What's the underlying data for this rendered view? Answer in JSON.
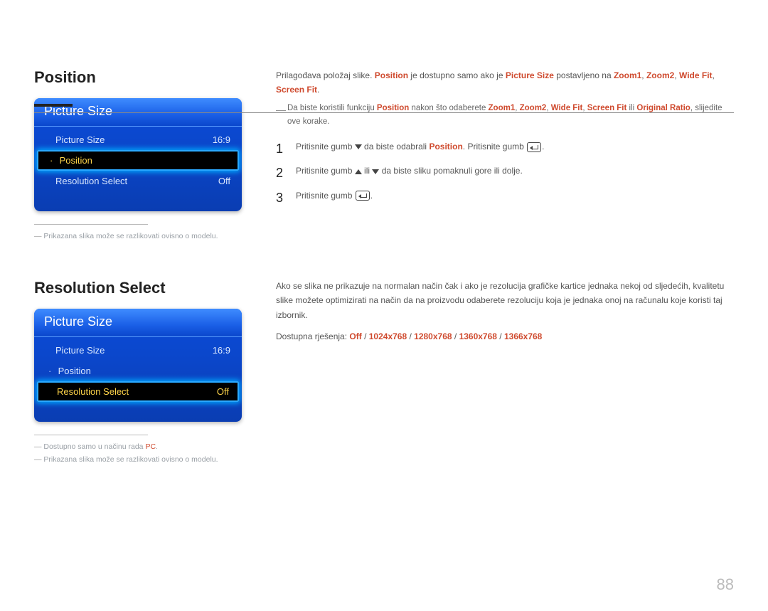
{
  "page_number": "88",
  "sections": [
    {
      "heading": "Position",
      "menu": {
        "title": "Picture Size",
        "items": [
          {
            "label": "Picture Size",
            "value": "16:9",
            "selected": false,
            "bullet": ""
          },
          {
            "label": "Position",
            "value": "",
            "selected": true,
            "bullet": "·"
          },
          {
            "label": "Resolution Select",
            "value": "Off",
            "selected": false,
            "bullet": ""
          }
        ]
      },
      "notes": [
        "Prikazana slika može se razlikovati ovisno o modelu."
      ],
      "intro_parts": {
        "p1a": "Prilagođava položaj slike. ",
        "p1b": "Position",
        "p1c": " je dostupno samo ako je ",
        "p1d": "Picture Size",
        "p1e": " postavljeno na ",
        "p1f": "Zoom1",
        "p1g": ", ",
        "p1h": "Zoom2",
        "p1i": ", ",
        "p1j": "Wide Fit",
        "p1k": ", ",
        "p1l": "Screen Fit",
        "p1m": "."
      },
      "dash_note_parts": {
        "a": "Da biste koristili funkciju ",
        "b": "Position",
        "c": " nakon što odaberete ",
        "d": "Zoom1",
        "e": ", ",
        "f": "Zoom2",
        "g": ", ",
        "h": "Wide Fit",
        "i": ", ",
        "j": "Screen Fit",
        "k": " ili ",
        "l": "Original Ratio",
        "m": ", slijedite ove korake."
      },
      "steps": {
        "s1a": "Pritisnite gumb ",
        "s1b": " da biste odabrali ",
        "s1c": "Position",
        "s1d": ". Pritisnite gumb ",
        "s1e": ".",
        "s2a": "Pritisnite gumb ",
        "s2b": " ili ",
        "s2c": " da biste sliku pomaknuli gore ili dolje.",
        "s3a": "Pritisnite gumb ",
        "s3b": "."
      }
    },
    {
      "heading": "Resolution Select",
      "menu": {
        "title": "Picture Size",
        "items": [
          {
            "label": "Picture Size",
            "value": "16:9",
            "selected": false,
            "bullet": ""
          },
          {
            "label": "Position",
            "value": "",
            "selected": false,
            "bullet": "·"
          },
          {
            "label": "Resolution Select",
            "value": "Off",
            "selected": true,
            "bullet": ""
          }
        ]
      },
      "notes": [
        "Dostupno samo u načinu rada PC.",
        "Prikazana slika može se razlikovati ovisno o modelu."
      ],
      "note_accent_index": 0,
      "note_accent_word": "PC",
      "body": {
        "p1": "Ako se slika ne prikazuje na normalan način čak i ako je rezolucija grafičke kartice jednaka nekoj od sljedećih, kvalitetu slike možete optimizirati na način da na proizvodu odaberete rezoluciju koja je jednaka onoj na računalu koje koristi taj izbornik.",
        "p2a": "Dostupna rješenja: ",
        "res": [
          "Off",
          "1024x768",
          "1280x768",
          "1360x768",
          "1366x768"
        ],
        "sep": " / "
      }
    }
  ]
}
